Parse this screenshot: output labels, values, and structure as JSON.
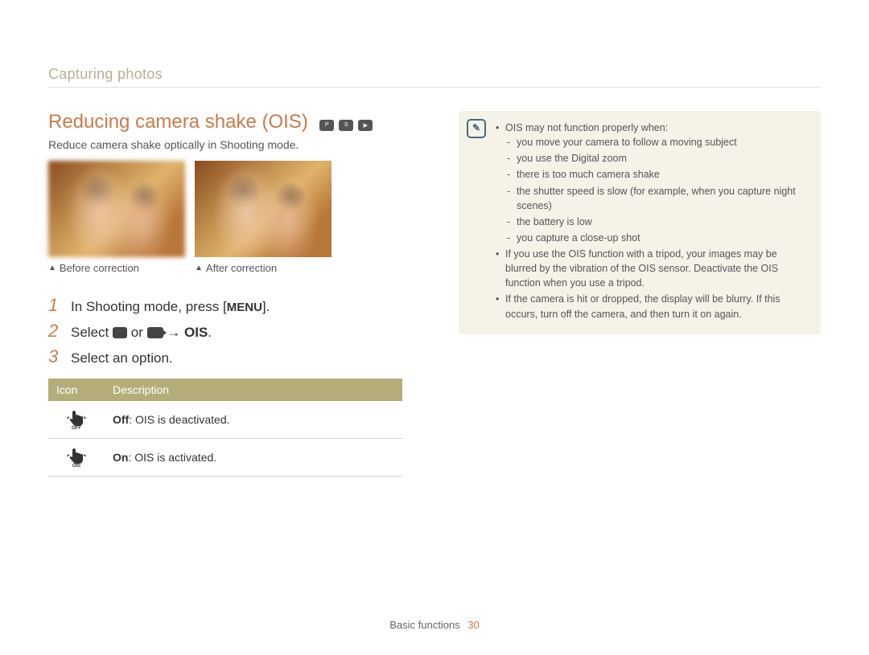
{
  "breadcrumb": "Capturing photos",
  "title": "Reducing camera shake (OIS)",
  "title_mode_icons": [
    "program-mode-icon",
    "scene-mode-icon",
    "video-mode-icon"
  ],
  "subtitle": "Reduce camera shake optically in Shooting mode.",
  "photos": {
    "before_caption": "Before correction",
    "after_caption": "After correction"
  },
  "steps": [
    {
      "num": "1",
      "pre": "In Shooting mode, press [",
      "btn": "MENU",
      "post": "]."
    },
    {
      "num": "2",
      "pre": "Select ",
      "mid": " or ",
      "arrow": " → ",
      "target": "OIS",
      "post": "."
    },
    {
      "num": "3",
      "text": "Select an option."
    }
  ],
  "table": {
    "header_icon": "Icon",
    "header_desc": "Description",
    "rows": [
      {
        "icon": "ois-off-icon",
        "label_bold": "Off",
        "label_rest": ": OIS is deactivated."
      },
      {
        "icon": "ois-on-icon",
        "label_bold": "On",
        "label_rest": ": OIS is activated."
      }
    ]
  },
  "note": {
    "intro": "OIS may not function properly when:",
    "sub": [
      "you move your camera to follow a moving subject",
      "you use the Digital zoom",
      "there is too much camera shake",
      "the shutter speed is slow (for example, when you capture night scenes)",
      "the battery is low",
      "you capture a close-up shot"
    ],
    "b2": "If you use the OIS function with a tripod, your images may be blurred by the vibration of the OIS sensor. Deactivate the OIS function when you use a tripod.",
    "b3": "If the camera is hit or dropped, the display will be blurry. If this occurs, turn off the camera, and then turn it on again."
  },
  "footer": {
    "section": "Basic functions",
    "page": "30"
  }
}
